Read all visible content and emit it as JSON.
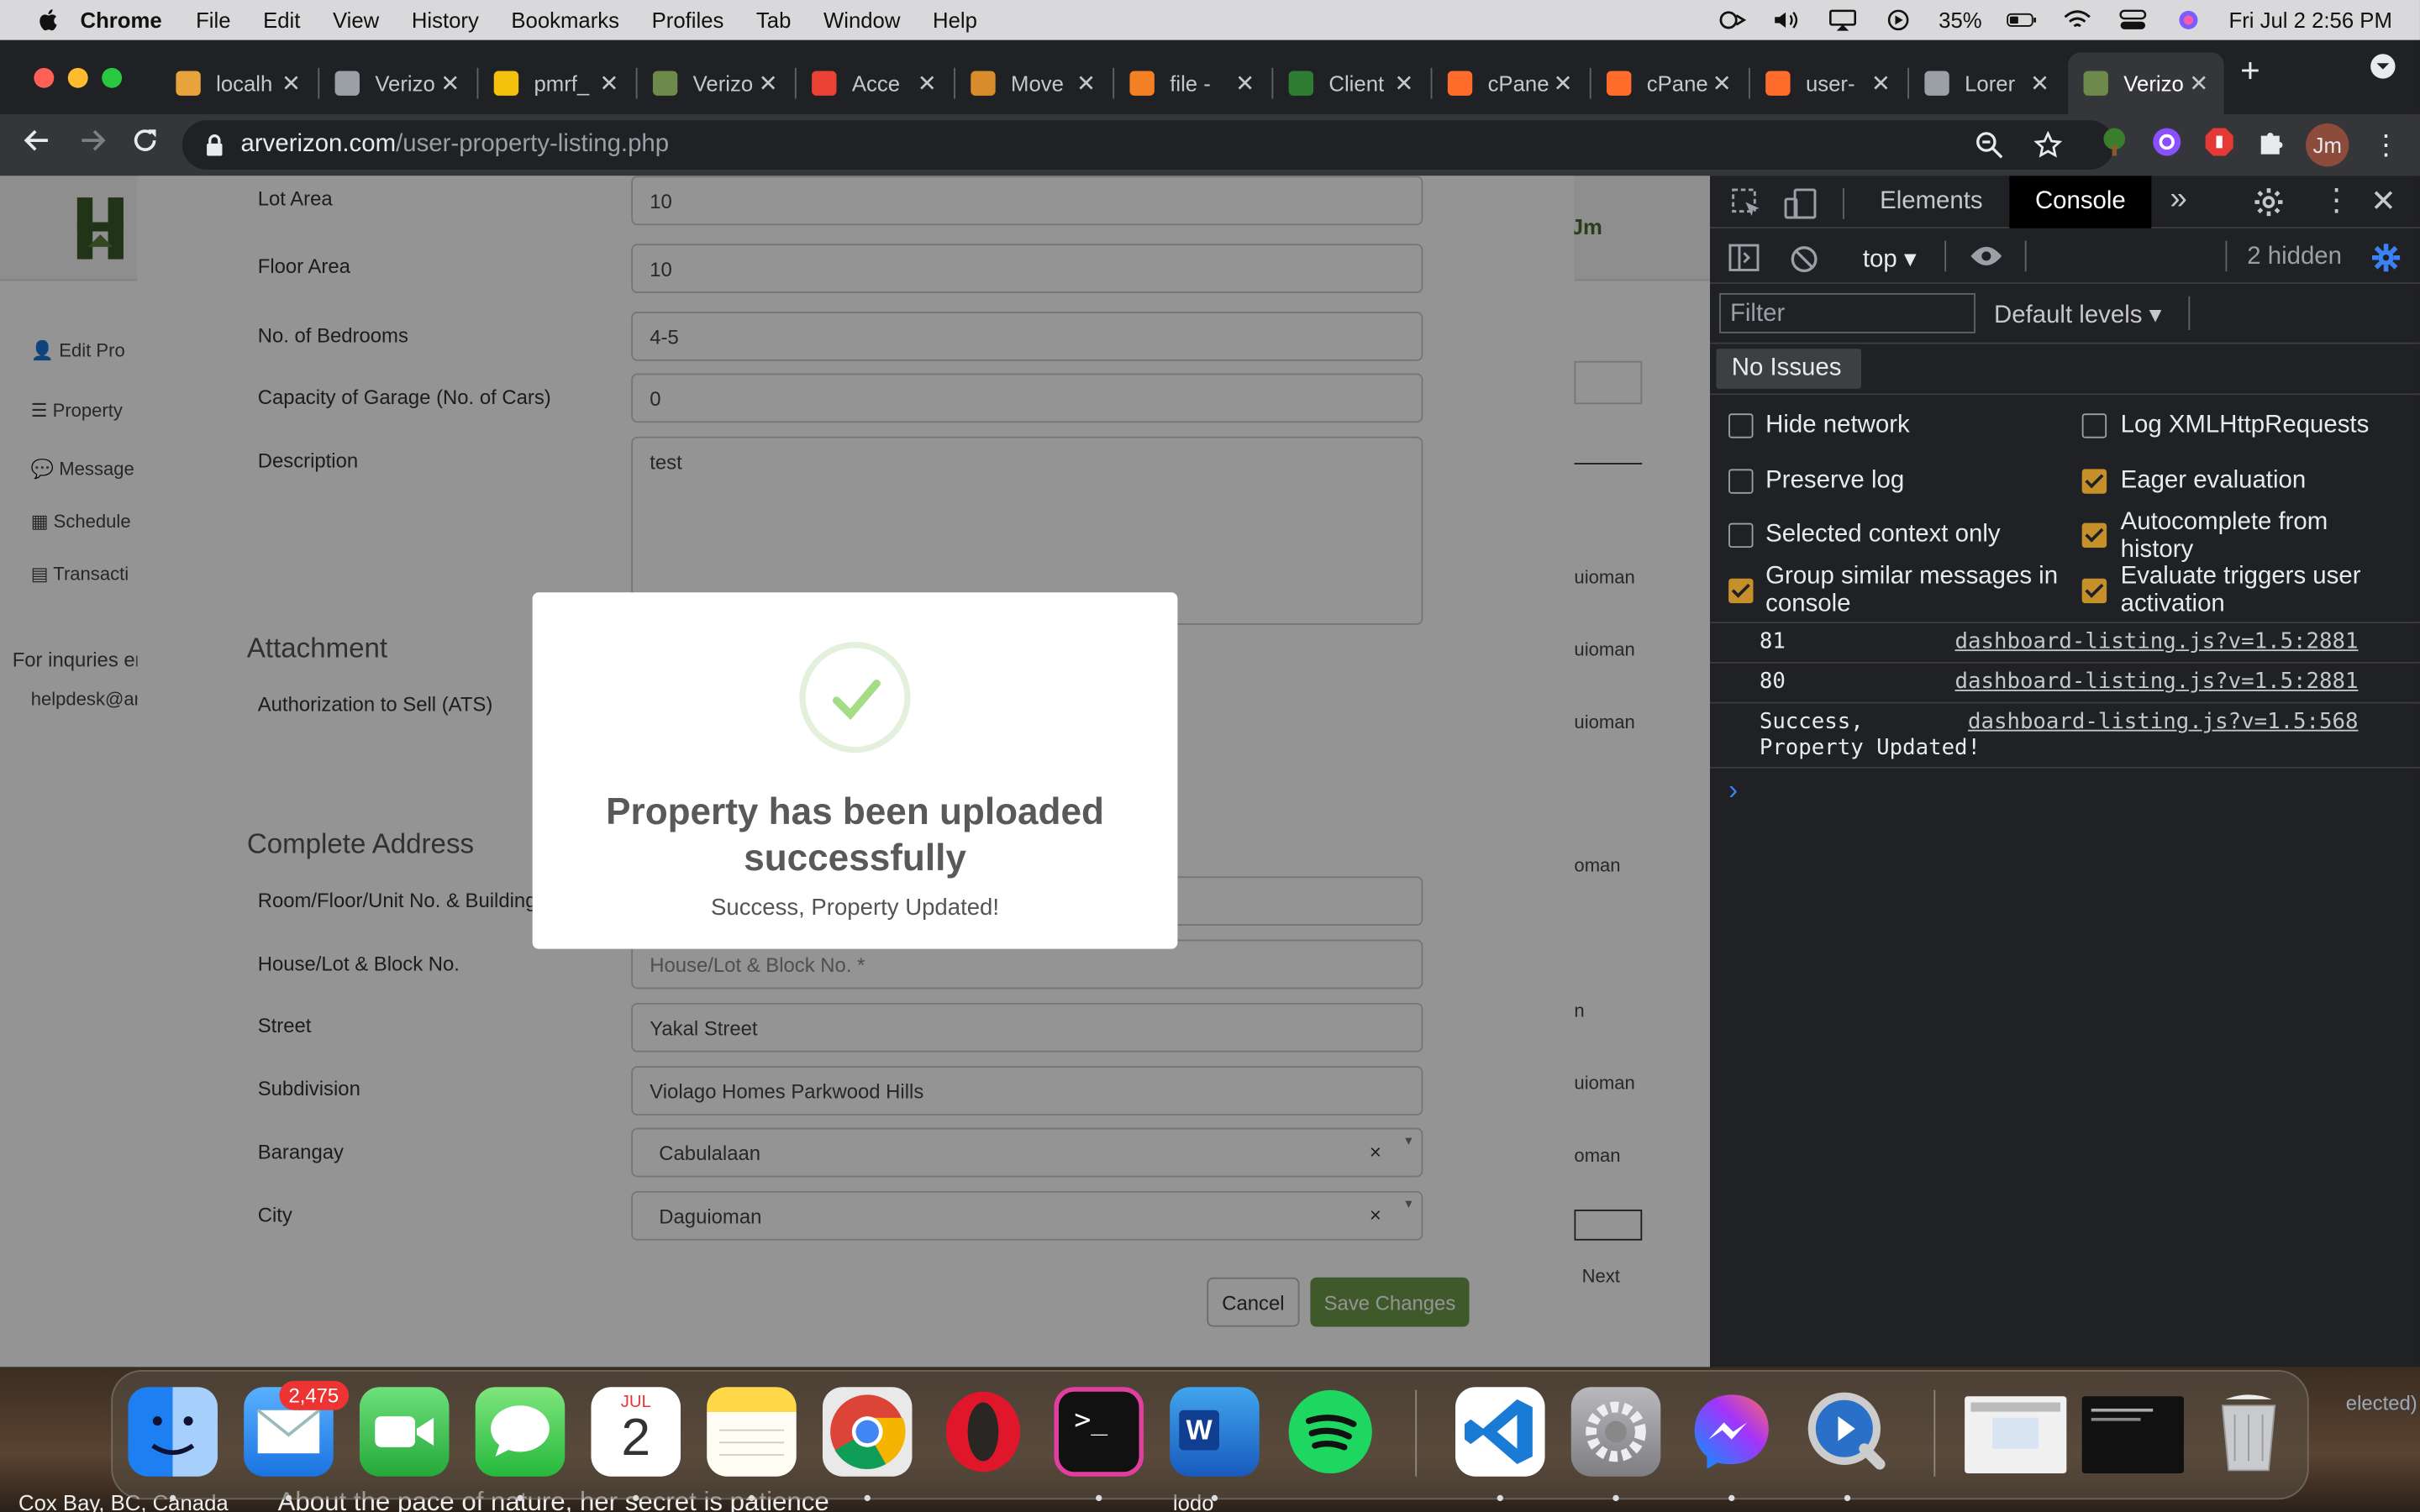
{
  "menubar": {
    "app": "Chrome",
    "items": [
      "File",
      "Edit",
      "View",
      "History",
      "Bookmarks",
      "Profiles",
      "Tab",
      "Window",
      "Help"
    ],
    "battery": "35%",
    "datetime": "Fri Jul 2  2:56 PM"
  },
  "tabs": [
    {
      "label": "localh",
      "color": "#e8a33d"
    },
    {
      "label": "Verizo",
      "color": "#9aa0a6"
    },
    {
      "label": "pmrf_",
      "color": "#f4c20d"
    },
    {
      "label": "Verizo",
      "color": "#6d8a4a"
    },
    {
      "label": "Acce",
      "color": "#ea4335"
    },
    {
      "label": "Move",
      "color": "#d98c2b"
    },
    {
      "label": "file -",
      "color": "#f48024"
    },
    {
      "label": "Client",
      "color": "#2e7d32"
    },
    {
      "label": "cPane",
      "color": "#ff6c2c"
    },
    {
      "label": "cPane",
      "color": "#ff6c2c"
    },
    {
      "label": "user-",
      "color": "#ff6c2c"
    },
    {
      "label": "Lorer",
      "color": "#9aa0a6"
    },
    {
      "label": "Verizo",
      "color": "#6d8a4a"
    }
  ],
  "address": {
    "host": "arverizon.com",
    "path": "/user-property-listing.php"
  },
  "profile_initials": "Jm",
  "sidebar": {
    "items": [
      "Edit Pro",
      "Property",
      "Message",
      "Schedule",
      "Transacti"
    ],
    "contact_label": "For inquries er",
    "contact_email": "helpdesk@ar"
  },
  "bg_column": [
    "uioman",
    "uioman",
    "uioman",
    "oman",
    "n",
    "uioman",
    "oman"
  ],
  "bg_next": "Next",
  "bg_user": "Jm",
  "form": {
    "fields": [
      {
        "label": "Lot Area",
        "value": "10"
      },
      {
        "label": "Floor Area",
        "value": "10"
      },
      {
        "label": "No. of Bedrooms",
        "value": "4-5"
      },
      {
        "label": "Capacity of Garage (No. of Cars)",
        "value": "0"
      }
    ],
    "description_label": "Description",
    "description_value": "test",
    "attachment_heading": "Attachment",
    "ats_label": "Authorization to Sell (ATS)",
    "address_heading": "Complete Address",
    "room_label": "Room/Floor/Unit No. & Building",
    "house_label": "House/Lot & Block No.",
    "house_placeholder": "House/Lot & Block No. *",
    "street_label": "Street",
    "street_value": "Yakal Street",
    "subdivision_label": "Subdivision",
    "subdivision_value": "Violago Homes Parkwood Hills",
    "barangay_label": "Barangay",
    "barangay_value": "Cabulalaan",
    "city_label": "City",
    "city_value": "Daguioman",
    "cancel": "Cancel",
    "save": "Save Changes"
  },
  "popup": {
    "title": "Property has been uploaded successfully",
    "message": "Success, Property Updated!"
  },
  "devtools": {
    "tab_elements": "Elements",
    "tab_console": "Console",
    "context": "top",
    "hidden": "2 hidden",
    "filter_placeholder": "Filter",
    "levels": "Default levels",
    "issues": "No Issues",
    "options": [
      {
        "label": "Hide network",
        "checked": false
      },
      {
        "label": "Log XMLHttpRequests",
        "checked": false
      },
      {
        "label": "Preserve log",
        "checked": false
      },
      {
        "label": "Eager evaluation",
        "checked": true
      },
      {
        "label": "Selected context only",
        "checked": false
      },
      {
        "label": "Autocomplete from history",
        "checked": true
      },
      {
        "label": "Group similar messages in console",
        "checked": true
      },
      {
        "label": "Evaluate triggers user activation",
        "checked": true
      }
    ],
    "logs": [
      {
        "value": "81",
        "source": "dashboard-listing.js?v=1.5:2881"
      },
      {
        "value": "80",
        "source": "dashboard-listing.js?v=1.5:2881"
      },
      {
        "value": "Success,\nProperty Updated!",
        "source": "dashboard-listing.js?v=1.5:568"
      }
    ],
    "prompt": "›"
  },
  "dock": {
    "mail_badge": "2,475",
    "calendar_month": "JUL",
    "calendar_day": "2",
    "apps": [
      "Finder",
      "Mail",
      "FaceTime",
      "Messages",
      "Calendar",
      "Notes",
      "Chrome",
      "Opera",
      "Terminal",
      "Word",
      "Spotify",
      "VS Code",
      "System Preferences",
      "Messenger",
      "QuickTime",
      "Preview",
      "Terminal window",
      "Trash"
    ]
  },
  "desktop": {
    "left_text": "Cox Bay, BC, Canada",
    "middle_text": "About the pace of nature, her secret is patience",
    "right_text": "lodo",
    "edge_text": "elected)"
  }
}
